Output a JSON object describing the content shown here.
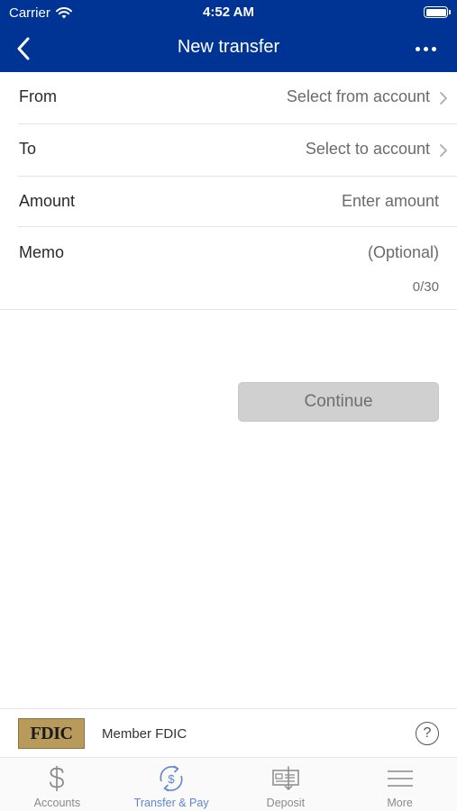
{
  "status_bar": {
    "carrier": "Carrier",
    "time": "4:52 AM"
  },
  "nav": {
    "title": "New transfer",
    "back_icon": "chevron-left-icon",
    "more_icon": "ellipsis-icon"
  },
  "form": {
    "from": {
      "label": "From",
      "value": "Select from account"
    },
    "to": {
      "label": "To",
      "value": "Select to account"
    },
    "amount": {
      "label": "Amount",
      "placeholder": "Enter amount"
    },
    "memo": {
      "label": "Memo",
      "placeholder": "(Optional)",
      "counter": "0/30"
    }
  },
  "continue_label": "Continue",
  "fdic": {
    "logo_text": "FDIC",
    "text": "Member FDIC"
  },
  "help": "?",
  "tabs": [
    {
      "label": "Accounts",
      "icon": "dollar-icon",
      "active": false
    },
    {
      "label": "Transfer & Pay",
      "icon": "transfer-pay-icon",
      "active": true
    },
    {
      "label": "Deposit",
      "icon": "deposit-check-icon",
      "active": false
    },
    {
      "label": "More",
      "icon": "menu-icon",
      "active": false
    }
  ],
  "colors": {
    "brand": "#003494",
    "active_tab": "#5d86cf",
    "inactive_tab": "#8a8a8a",
    "disabled_button": "#d0d0d0"
  }
}
